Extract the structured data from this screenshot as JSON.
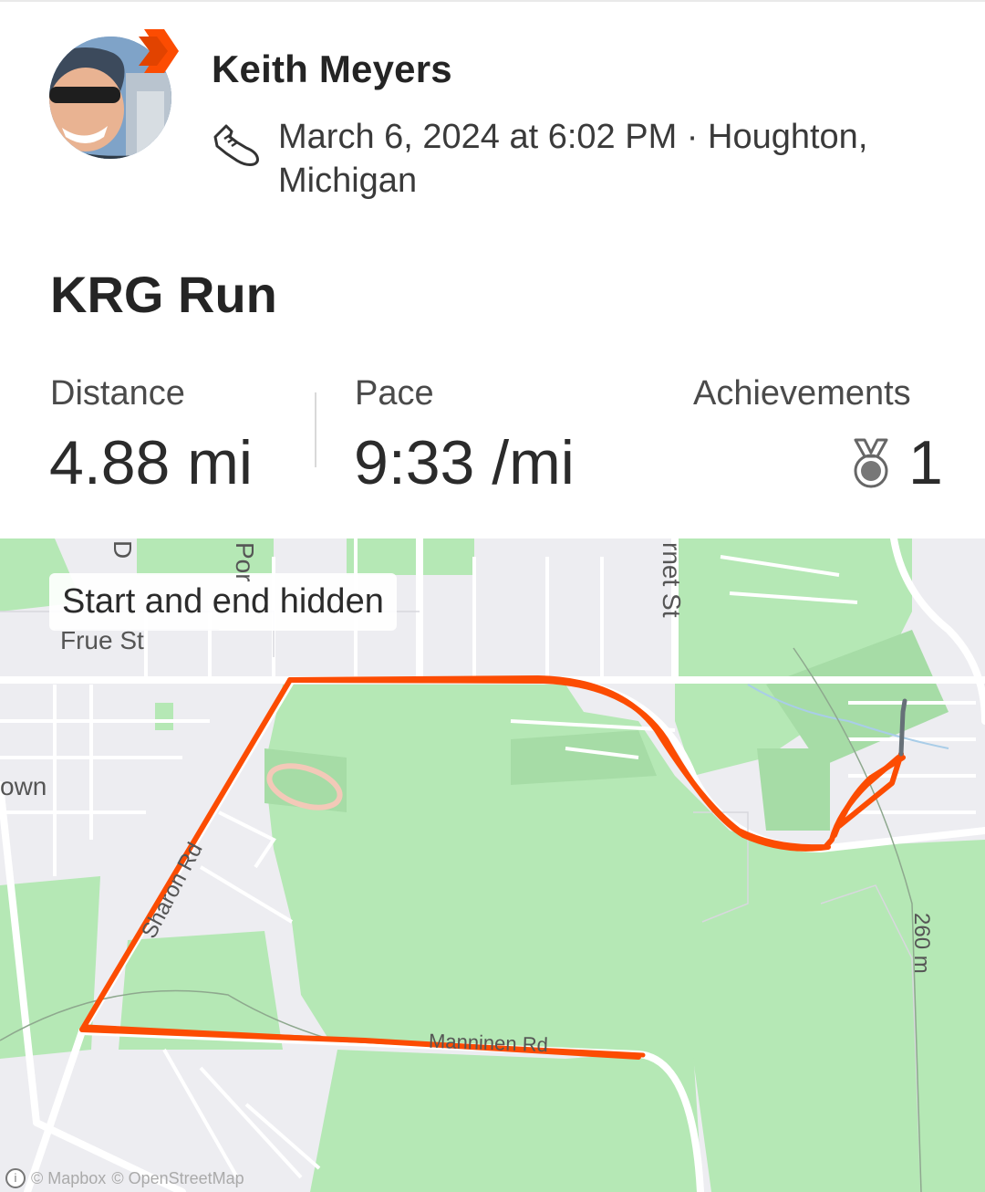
{
  "athlete": {
    "name": "Keith Meyers"
  },
  "activity": {
    "meta": "March 6, 2024 at 6:02 PM · Houghton, Michigan",
    "title": "KRG Run",
    "sport_icon": "running-shoe-icon"
  },
  "stats": {
    "distance": {
      "label": "Distance",
      "value": "4.88 mi"
    },
    "pace": {
      "label": "Pace",
      "value": "9:33 /mi"
    },
    "achievements": {
      "label": "Achievements",
      "value": "1",
      "icon": "medal-icon"
    }
  },
  "map": {
    "privacy_label": "Start and end hidden",
    "street_labels": [
      "D",
      "Por",
      "rnet St",
      "Frue St",
      "own",
      "Sharon Rd",
      "Manninen Rd",
      "260 m"
    ],
    "attribution_mapbox": "© Mapbox",
    "attribution_osm": "© OpenStreetMap",
    "route_color": "#fc4c02"
  },
  "colors": {
    "brand": "#fc4c02",
    "park": "#b5e8b5",
    "land": "#ededf1"
  }
}
